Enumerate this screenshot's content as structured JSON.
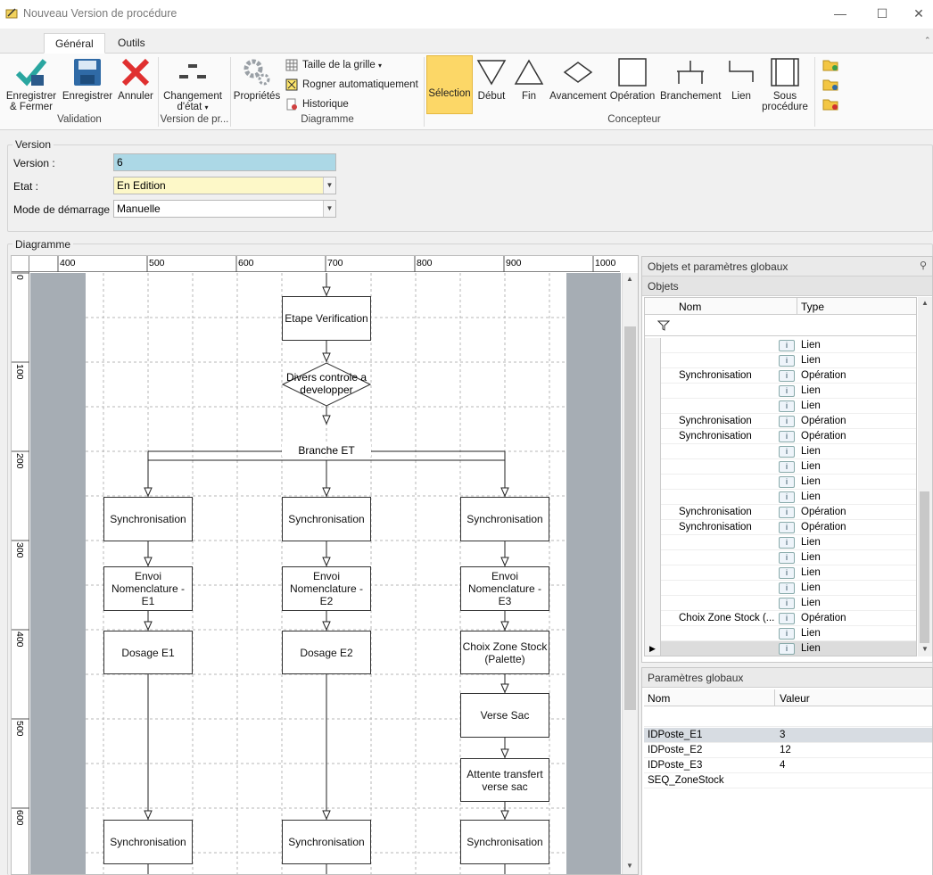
{
  "window": {
    "title": "Nouveau Version de procédure"
  },
  "ribbon": {
    "tabs": [
      "Général",
      "Outils"
    ],
    "validation": {
      "save_close": "Enregistrer & Fermer",
      "save": "Enregistrer",
      "cancel": "Annuler",
      "label": "Validation"
    },
    "version": {
      "change_state": "Changement d'état",
      "label": "Version de pr..."
    },
    "diagramme": {
      "properties": "Propriétés",
      "grid_size": "Taille de la grille",
      "auto_crop": "Rogner automatiquement",
      "history": "Historique",
      "label": "Diagramme"
    },
    "concepteur": {
      "label": "Concepteur",
      "tools": [
        "Sélection",
        "Début",
        "Fin",
        "Avancement",
        "Opération",
        "Branchement",
        "Lien",
        "Sous procédure"
      ]
    }
  },
  "version_section": {
    "title": "Version",
    "version_label": "Version :",
    "version_value": "6",
    "etat_label": "Etat :",
    "etat_value": "En Edition",
    "mode_label": "Mode de démarrage :",
    "mode_value": "Manuelle"
  },
  "diagram_section": {
    "title": "Diagramme",
    "ruler_x": [
      "400",
      "500",
      "600",
      "700",
      "800",
      "900",
      "1000"
    ],
    "ruler_y": [
      "0",
      "100",
      "200",
      "300",
      "400",
      "500",
      "600"
    ],
    "nodes": {
      "etape": "Etape Verification",
      "divers": "Divers controle a developper",
      "branche": "Branche ET",
      "sync1": "Synchronisation",
      "sync2": "Synchronisation",
      "sync3": "Synchronisation",
      "envoi1": "Envoi Nomenclature - E1",
      "envoi2": "Envoi Nomenclature - E2",
      "envoi3": "Envoi Nomenclature - E3",
      "dosage1": "Dosage E1",
      "dosage2": "Dosage E2",
      "choix": "Choix Zone Stock (Palette)",
      "verse": "Verse Sac",
      "attente": "Attente transfert verse sac",
      "sync4": "Synchronisation",
      "sync5": "Synchronisation",
      "sync6": "Synchronisation"
    }
  },
  "objects_panel": {
    "title": "Objets et paramètres globaux",
    "subtitle": "Objets",
    "col_nom": "Nom",
    "col_type": "Type",
    "rows": [
      {
        "nom": "",
        "type": "Lien"
      },
      {
        "nom": "",
        "type": "Lien"
      },
      {
        "nom": "Synchronisation",
        "type": "Opération"
      },
      {
        "nom": "",
        "type": "Lien"
      },
      {
        "nom": "",
        "type": "Lien"
      },
      {
        "nom": "Synchronisation",
        "type": "Opération"
      },
      {
        "nom": "Synchronisation",
        "type": "Opération"
      },
      {
        "nom": "",
        "type": "Lien"
      },
      {
        "nom": "",
        "type": "Lien"
      },
      {
        "nom": "",
        "type": "Lien"
      },
      {
        "nom": "",
        "type": "Lien"
      },
      {
        "nom": "Synchronisation",
        "type": "Opération"
      },
      {
        "nom": "Synchronisation",
        "type": "Opération"
      },
      {
        "nom": "",
        "type": "Lien"
      },
      {
        "nom": "",
        "type": "Lien"
      },
      {
        "nom": "",
        "type": "Lien"
      },
      {
        "nom": "",
        "type": "Lien"
      },
      {
        "nom": "",
        "type": "Lien"
      },
      {
        "nom": "Choix Zone Stock (...",
        "type": "Opération"
      },
      {
        "nom": "",
        "type": "Lien"
      },
      {
        "nom": "",
        "type": "Lien"
      }
    ]
  },
  "params_panel": {
    "title": "Paramètres globaux",
    "col_nom": "Nom",
    "col_valeur": "Valeur",
    "rows": [
      {
        "nom": "IDPoste_E1",
        "valeur": "3"
      },
      {
        "nom": "IDPoste_E2",
        "valeur": "12"
      },
      {
        "nom": "IDPoste_E3",
        "valeur": "4"
      },
      {
        "nom": "SEQ_ZoneStock",
        "valeur": ""
      }
    ]
  }
}
